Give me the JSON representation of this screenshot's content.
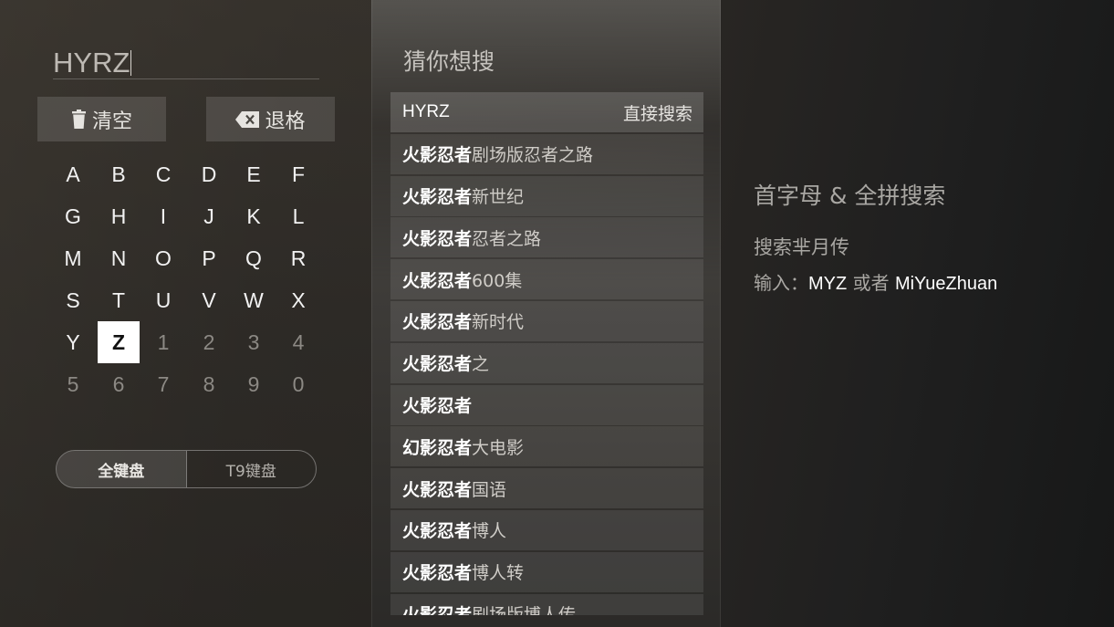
{
  "search": {
    "query": "HYRZ"
  },
  "buttons": {
    "clear_label": "清空",
    "backspace_label": "退格"
  },
  "keyboard": {
    "rows": [
      [
        "A",
        "B",
        "C",
        "D",
        "E",
        "F"
      ],
      [
        "G",
        "H",
        "I",
        "J",
        "K",
        "L"
      ],
      [
        "M",
        "N",
        "O",
        "P",
        "Q",
        "R"
      ],
      [
        "S",
        "T",
        "U",
        "V",
        "W",
        "X"
      ],
      [
        "Y",
        "Z",
        "1",
        "2",
        "3",
        "4"
      ],
      [
        "5",
        "6",
        "7",
        "8",
        "9",
        "0"
      ]
    ],
    "selected": "Z"
  },
  "keyboard_modes": {
    "full": "全键盘",
    "t9": "T9键盘",
    "active": "full"
  },
  "suggestions": {
    "title": "猜你想搜",
    "direct_label": "直接搜索",
    "first_query": "HYRZ",
    "items": [
      {
        "hl": "火影忍者",
        "rest": "剧场版忍者之路"
      },
      {
        "hl": "火影忍者",
        "rest": "新世纪"
      },
      {
        "hl": "火影忍者",
        "rest": "忍者之路"
      },
      {
        "hl": "火影忍者",
        "rest": "600集"
      },
      {
        "hl": "火影忍者",
        "rest": "新时代"
      },
      {
        "hl": "火影忍者",
        "rest": "之"
      },
      {
        "hl": "火影忍者",
        "rest": ""
      },
      {
        "hl": "幻影忍者",
        "rest": "大电影"
      },
      {
        "hl": "火影忍者",
        "rest": "国语"
      },
      {
        "hl": "火影忍者",
        "rest": "博人"
      },
      {
        "hl": "火影忍者",
        "rest": "博人转"
      },
      {
        "hl": "火影忍者",
        "rest": "剧场版博人传"
      }
    ]
  },
  "help": {
    "title": "首字母 & 全拼搜索",
    "example": "搜索芈月传",
    "input_prefix": "输入：",
    "abbr": "MYZ",
    "or_text": " 或者 ",
    "full": "MiYueZhuan"
  }
}
